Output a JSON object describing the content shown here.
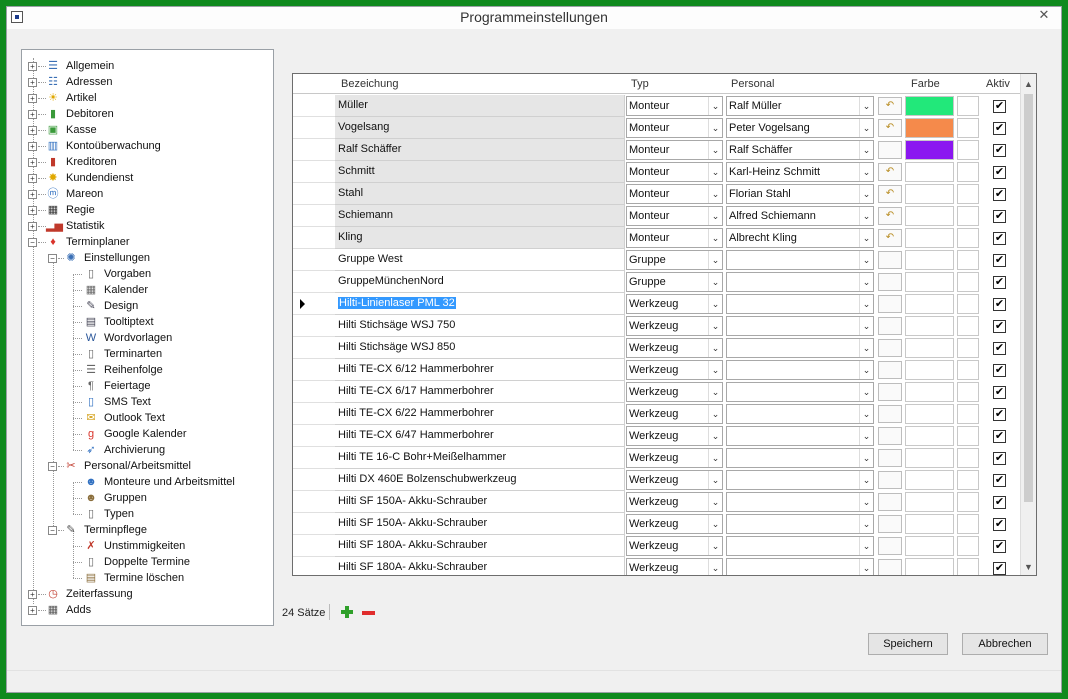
{
  "window": {
    "title": "Programmeinstellungen",
    "close": "✕"
  },
  "tree": {
    "items": [
      {
        "label": "Allgemein",
        "icon": "list-icon",
        "glyph": "☰",
        "color": "#3a6fb5"
      },
      {
        "label": "Adressen",
        "icon": "person-list-icon",
        "glyph": "☷",
        "color": "#3a6fb5"
      },
      {
        "label": "Artikel",
        "icon": "sun-icon",
        "glyph": "☀",
        "color": "#e0a800"
      },
      {
        "label": "Debitoren",
        "icon": "book-icon",
        "glyph": "▮",
        "color": "#3a9a3a"
      },
      {
        "label": "Kasse",
        "icon": "cash-icon",
        "glyph": "▣",
        "color": "#3a9a3a"
      },
      {
        "label": "Kontoüberwachung",
        "icon": "account-icon",
        "glyph": "▥",
        "color": "#2f6fc0"
      },
      {
        "label": "Kreditoren",
        "icon": "book-red-icon",
        "glyph": "▮",
        "color": "#c0392b"
      },
      {
        "label": "Kundendienst",
        "icon": "star-icon",
        "glyph": "✸",
        "color": "#e0a800"
      },
      {
        "label": "Mareon",
        "icon": "mareon-icon",
        "glyph": "ⓜ",
        "color": "#2f6fc0"
      },
      {
        "label": "Regie",
        "icon": "clapboard-icon",
        "glyph": "▦",
        "color": "#333"
      },
      {
        "label": "Statistik",
        "icon": "chart-icon",
        "glyph": "▂▅",
        "color": "#c0392b"
      },
      {
        "label": "Terminplaner",
        "icon": "calendar-heart-icon",
        "glyph": "♦",
        "color": "#d9342b"
      },
      {
        "label": "Einstellungen",
        "icon": "gear-icon",
        "glyph": "✺",
        "color": "#3a6fb5"
      },
      {
        "label": "Vorgaben",
        "icon": "document-icon",
        "glyph": "▯",
        "color": "#666"
      },
      {
        "label": "Kalender",
        "icon": "calendar-icon",
        "glyph": "▦",
        "color": "#666"
      },
      {
        "label": "Design",
        "icon": "brush-icon",
        "glyph": "✎",
        "color": "#445"
      },
      {
        "label": "Tooltiptext",
        "icon": "tooltip-icon",
        "glyph": "▤",
        "color": "#445"
      },
      {
        "label": "Wordvorlagen",
        "icon": "word-icon",
        "glyph": "W",
        "color": "#2b579a"
      },
      {
        "label": "Terminarten",
        "icon": "document-icon",
        "glyph": "▯",
        "color": "#666"
      },
      {
        "label": "Reihenfolge",
        "icon": "list-icon",
        "glyph": "☰",
        "color": "#666"
      },
      {
        "label": "Feiertage",
        "icon": "holiday-icon",
        "glyph": "¶",
        "color": "#666"
      },
      {
        "label": "SMS Text",
        "icon": "phone-icon",
        "glyph": "▯",
        "color": "#2f6fc0"
      },
      {
        "label": "Outlook Text",
        "icon": "envelope-icon",
        "glyph": "✉",
        "color": "#d4a017"
      },
      {
        "label": "Google Kalender",
        "icon": "google-icon",
        "glyph": "g",
        "color": "#d9342b"
      },
      {
        "label": "Archivierung",
        "icon": "archive-icon",
        "glyph": "➶",
        "color": "#2f6fc0"
      },
      {
        "label": "Personal/Arbeitsmittel",
        "icon": "tools-icon",
        "glyph": "✂",
        "color": "#c0392b"
      },
      {
        "label": "Monteure und Arbeitsmittel",
        "icon": "worker-icon",
        "glyph": "☻",
        "color": "#2f6fc0"
      },
      {
        "label": "Gruppen",
        "icon": "group-icon",
        "glyph": "☻",
        "color": "#8a6d3b"
      },
      {
        "label": "Typen",
        "icon": "document-icon",
        "glyph": "▯",
        "color": "#666"
      },
      {
        "label": "Terminpflege",
        "icon": "clipboard-icon",
        "glyph": "✎",
        "color": "#555"
      },
      {
        "label": "Unstimmigkeiten",
        "icon": "alert-icon",
        "glyph": "✗",
        "color": "#c0392b"
      },
      {
        "label": "Doppelte Termine",
        "icon": "duplicate-icon",
        "glyph": "▯",
        "color": "#666"
      },
      {
        "label": "Termine löschen",
        "icon": "delete-doc-icon",
        "glyph": "▤",
        "color": "#8a6d3b"
      },
      {
        "label": "Zeiterfassung",
        "icon": "clock-icon",
        "glyph": "◷",
        "color": "#c0392b"
      },
      {
        "label": "Adds",
        "icon": "addons-icon",
        "glyph": "▦",
        "color": "#555"
      }
    ]
  },
  "grid": {
    "columns": {
      "bezeichnung": "Bezeichung",
      "typ": "Typ",
      "personal": "Personal",
      "farbe": "Farbe",
      "aktiv": "Aktiv"
    },
    "rows": [
      {
        "name": "Müller",
        "typ": "Monteur",
        "personal": "Ralf Müller",
        "revert": true,
        "color": "#22e87a",
        "aktiv": true,
        "gray": true
      },
      {
        "name": "Vogelsang",
        "typ": "Monteur",
        "personal": "Peter Vogelsang",
        "revert": true,
        "color": "#f58a4b",
        "aktiv": true,
        "gray": true
      },
      {
        "name": "Ralf Schäffer",
        "typ": "Monteur",
        "personal": "Ralf Schäffer",
        "revert": false,
        "color": "#8b17f0",
        "aktiv": true,
        "gray": true
      },
      {
        "name": "Schmitt",
        "typ": "Monteur",
        "personal": "Karl-Heinz Schmitt",
        "revert": true,
        "color": "",
        "aktiv": true,
        "gray": true
      },
      {
        "name": "Stahl",
        "typ": "Monteur",
        "personal": "Florian Stahl",
        "revert": true,
        "color": "",
        "aktiv": true,
        "gray": true
      },
      {
        "name": "Schiemann",
        "typ": "Monteur",
        "personal": "Alfred Schiemann",
        "revert": true,
        "color": "",
        "aktiv": true,
        "gray": true
      },
      {
        "name": "Kling",
        "typ": "Monteur",
        "personal": "Albrecht Kling",
        "revert": true,
        "color": "",
        "aktiv": true,
        "gray": true
      },
      {
        "name": "Gruppe West",
        "typ": "Gruppe",
        "personal": "",
        "revert": false,
        "color": "",
        "aktiv": true,
        "gray": false
      },
      {
        "name": "GruppeMünchenNord",
        "typ": "Gruppe",
        "personal": "",
        "revert": false,
        "color": "",
        "aktiv": true,
        "gray": false
      },
      {
        "name": "Hilti-Linienlaser PML 32",
        "typ": "Werkzeug",
        "personal": "",
        "revert": false,
        "color": "",
        "aktiv": true,
        "gray": false,
        "selected": true
      },
      {
        "name": "Hilti Stichsäge WSJ 750",
        "typ": "Werkzeug",
        "personal": "",
        "revert": false,
        "color": "",
        "aktiv": true,
        "gray": false
      },
      {
        "name": "Hilti Stichsäge WSJ 850",
        "typ": "Werkzeug",
        "personal": "",
        "revert": false,
        "color": "",
        "aktiv": true,
        "gray": false
      },
      {
        "name": "Hilti TE-CX 6/12 Hammerbohrer",
        "typ": "Werkzeug",
        "personal": "",
        "revert": false,
        "color": "",
        "aktiv": true,
        "gray": false
      },
      {
        "name": "Hilti TE-CX 6/17 Hammerbohrer",
        "typ": "Werkzeug",
        "personal": "",
        "revert": false,
        "color": "",
        "aktiv": true,
        "gray": false
      },
      {
        "name": "Hilti TE-CX 6/22 Hammerbohrer",
        "typ": "Werkzeug",
        "personal": "",
        "revert": false,
        "color": "",
        "aktiv": true,
        "gray": false
      },
      {
        "name": "Hilti TE-CX 6/47 Hammerbohrer",
        "typ": "Werkzeug",
        "personal": "",
        "revert": false,
        "color": "",
        "aktiv": true,
        "gray": false
      },
      {
        "name": "Hilti TE 16-C Bohr+Meißelhammer",
        "typ": "Werkzeug",
        "personal": "",
        "revert": false,
        "color": "",
        "aktiv": true,
        "gray": false
      },
      {
        "name": "Hilti DX 460E Bolzenschubwerkzeug",
        "typ": "Werkzeug",
        "personal": "",
        "revert": false,
        "color": "",
        "aktiv": true,
        "gray": false
      },
      {
        "name": "Hilti SF 150A- Akku-Schrauber",
        "typ": "Werkzeug",
        "personal": "",
        "revert": false,
        "color": "",
        "aktiv": true,
        "gray": false
      },
      {
        "name": "Hilti SF 150A- Akku-Schrauber",
        "typ": "Werkzeug",
        "personal": "",
        "revert": false,
        "color": "",
        "aktiv": true,
        "gray": false
      },
      {
        "name": "Hilti SF 180A- Akku-Schrauber",
        "typ": "Werkzeug",
        "personal": "",
        "revert": false,
        "color": "",
        "aktiv": true,
        "gray": false
      },
      {
        "name": "Hilti SF 180A- Akku-Schrauber",
        "typ": "Werkzeug",
        "personal": "",
        "revert": false,
        "color": "",
        "aktiv": true,
        "gray": false
      }
    ]
  },
  "footer": {
    "count": "24 Sätze"
  },
  "buttons": {
    "save": "Speichern",
    "cancel": "Abbrechen"
  }
}
